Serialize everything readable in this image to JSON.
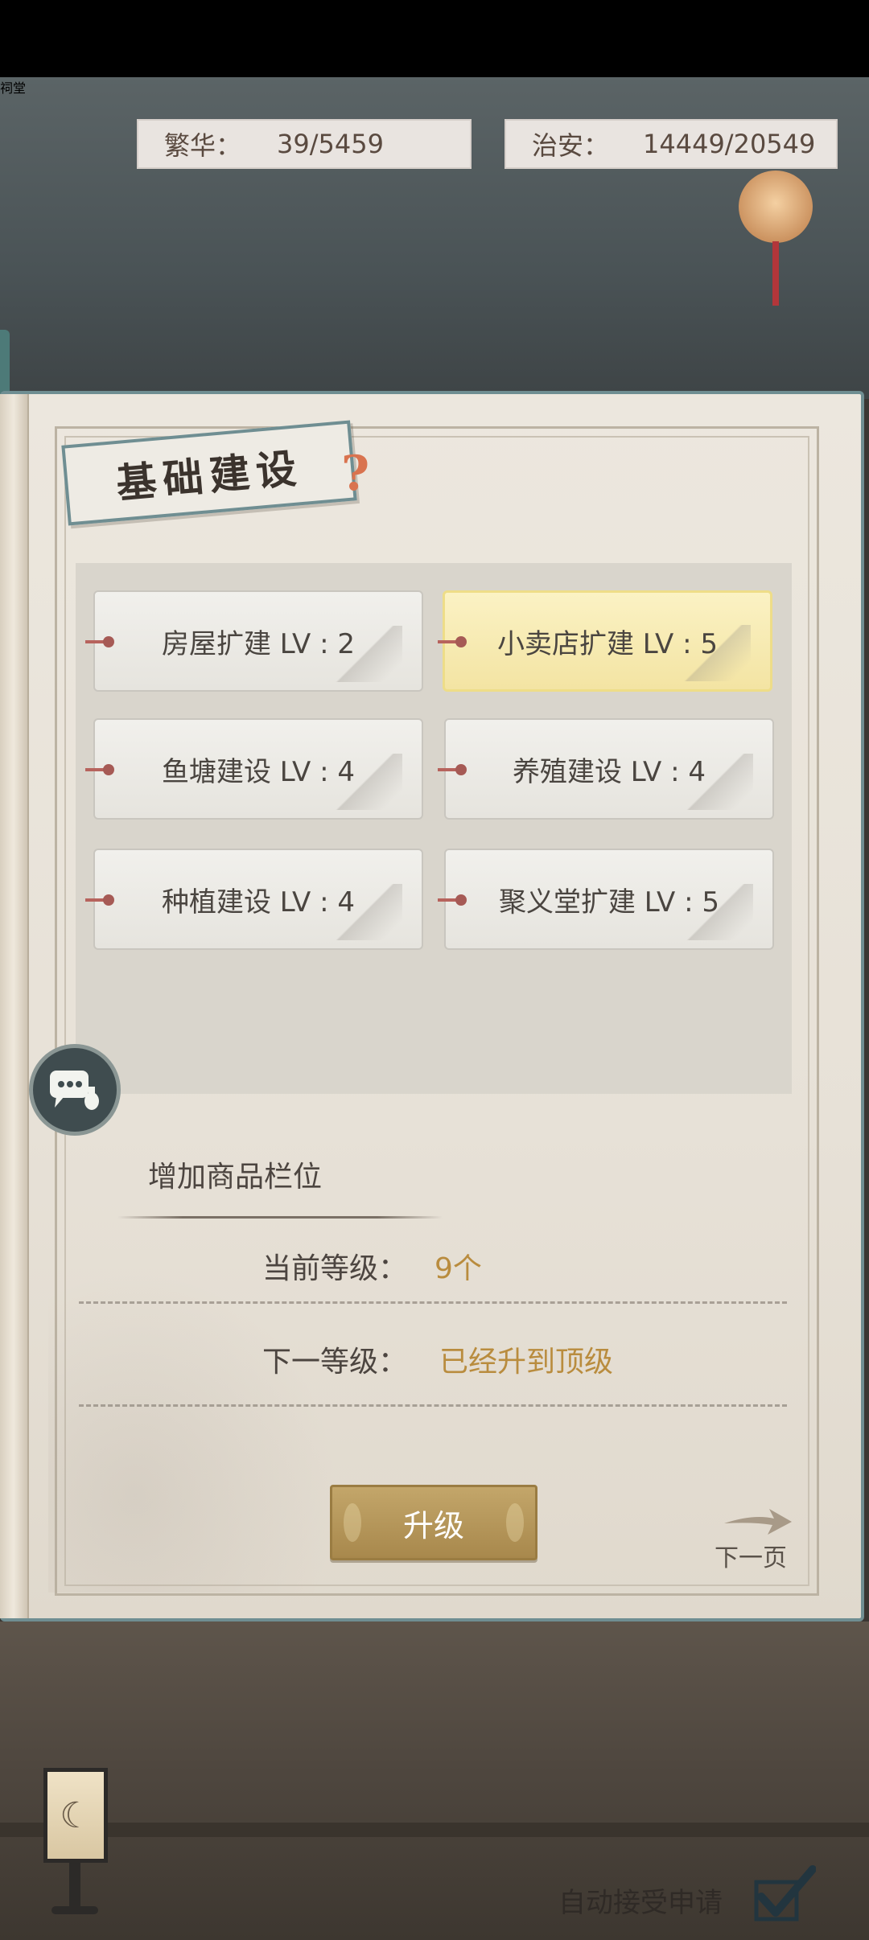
{
  "scene": {
    "plaque_text": "祠堂"
  },
  "stats": [
    {
      "label": "繁华：",
      "value": "39/5459"
    },
    {
      "label": "治安：",
      "value": "14449/20549"
    }
  ],
  "panel": {
    "title": "基础建设",
    "help_glyph": "?"
  },
  "buildings": [
    {
      "label": "房屋扩建 LV : 2",
      "selected": false
    },
    {
      "label": "小卖店扩建 LV : 5",
      "selected": true
    },
    {
      "label": "鱼塘建设 LV : 4",
      "selected": false
    },
    {
      "label": "养殖建设 LV : 4",
      "selected": false
    },
    {
      "label": "种植建设 LV : 4",
      "selected": false
    },
    {
      "label": "聚义堂扩建 LV : 5",
      "selected": false
    }
  ],
  "detail": {
    "description": "增加商品栏位",
    "current_label": "当前等级：",
    "current_value": "9个",
    "next_label": "下一等级：",
    "next_value": "已经升到顶级"
  },
  "actions": {
    "upgrade_label": "升级",
    "next_page_label": "下一页"
  },
  "footer": {
    "auto_accept_label": "自动接受申请",
    "auto_accept_checked": true,
    "lamp_glyph": "☾"
  },
  "colors": {
    "accent_gold": "#b98c3e",
    "selected_card": "#f3e4a3",
    "frame_teal": "#6f8e92"
  }
}
